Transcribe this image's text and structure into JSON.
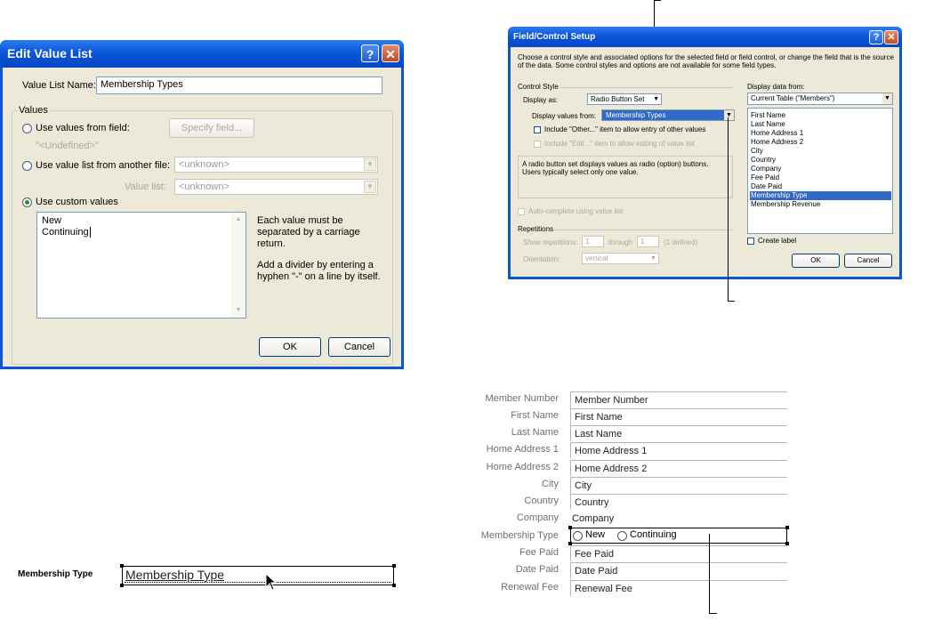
{
  "edit_value_list": {
    "title": "Edit Value List",
    "value_list_name_label": "Value List Name:",
    "value_list_name_value": "Membership Types",
    "values_group_label": "Values",
    "use_values_from_field": "Use values from field:",
    "specify_field_button": "Specify field...",
    "undefined_text": "\"<Undefined>\"",
    "use_value_list_from_file": "Use value list from another file:",
    "file_combo_value": "<unknown>",
    "value_list_label": "Value list:",
    "value_list_combo_value": "<unknown>",
    "use_custom_values": "Use custom values",
    "custom_values": [
      "New",
      "Continuing"
    ],
    "hint_1": "Each value must be separated by a carriage return.",
    "hint_2": "Add a divider by entering a hyphen \"-\" on a line by itself.",
    "ok_label": "OK",
    "cancel_label": "Cancel",
    "selected_option": "use_custom_values"
  },
  "field_control_setup": {
    "title": "Field/Control Setup",
    "description": "Choose a control style and associated options for the selected field or field control, or change the field that is the source of the data. Some control styles and options are not available for some field types.",
    "control_style_label": "Control Style",
    "display_as_label": "Display as:",
    "display_as_value": "Radio Button Set",
    "display_values_from_label": "Display values from:",
    "display_values_from_value": "Membership Types",
    "include_other": "Include \"Other...\" item to allow entry of other values",
    "include_edit": "Include \"Edit...\" item to allow editing of value list",
    "control_description": "A radio button set displays values as radio (option) buttons. Users typically select only one value.",
    "auto_complete": "Auto-complete using value list",
    "repetitions_label": "Repetitions",
    "show_repetitions_label": "Show repetitions:",
    "show_rep_from": "1",
    "through_label": "through",
    "show_rep_to": "1",
    "defined_text": "(1 defined)",
    "orientation_label": "Orientation:",
    "orientation_value": "vertical",
    "display_data_from_label": "Display data from:",
    "table_value": "Current Table (\"Members\")",
    "fields": [
      "First Name",
      "Last Name",
      "Home Address 1",
      "Home Address 2",
      "City",
      "Country",
      "Company",
      "Fee Paid",
      "Date Paid",
      "Membership Type",
      "Membership Revenue"
    ],
    "selected_field": "Membership Type",
    "create_label": "Create label",
    "ok_label": "OK",
    "cancel_label": "Cancel"
  },
  "layout_field": {
    "label": "Membership Type",
    "value": "Membership Type"
  },
  "form": {
    "rows": [
      {
        "label": "Member Number",
        "value": "Member Number"
      },
      {
        "label": "First Name",
        "value": "First Name"
      },
      {
        "label": "Last Name",
        "value": "Last Name"
      },
      {
        "label": "Home Address 1",
        "value": "Home Address 1"
      },
      {
        "label": "Home Address 2",
        "value": "Home Address 2"
      },
      {
        "label": "City",
        "value": "City"
      },
      {
        "label": "Country",
        "value": "Country"
      },
      {
        "label": "Company",
        "value": "Company"
      },
      {
        "label": "Membership Type",
        "value": ""
      },
      {
        "label": "Fee Paid",
        "value": "Fee Paid"
      },
      {
        "label": "Date Paid",
        "value": "Date Paid"
      },
      {
        "label": "Renewal Fee",
        "value": "Renewal Fee"
      }
    ],
    "radio_options": [
      "New",
      "Continuing"
    ]
  }
}
